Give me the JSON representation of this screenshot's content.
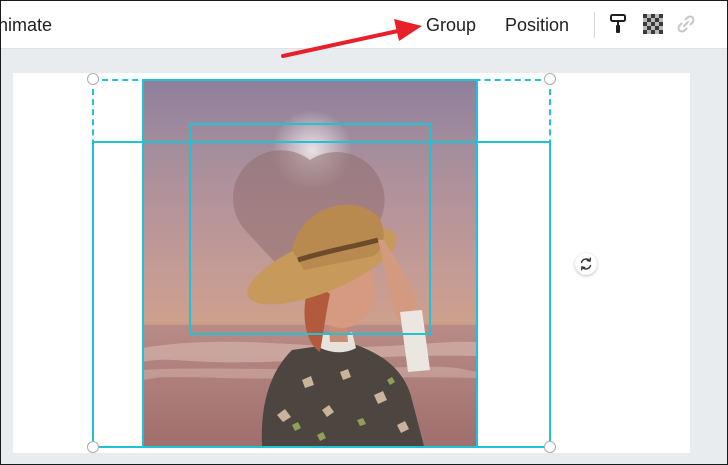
{
  "toolbar": {
    "animate_label": "nimate",
    "group_label": "Group",
    "position_label": "Position",
    "icons": [
      "paint-roller-icon",
      "transparency-icon",
      "link-icon"
    ]
  },
  "canvas": {
    "background": "#ffffff",
    "selection_color": "#1fc3d4",
    "annotation_color": "#e8202a"
  }
}
